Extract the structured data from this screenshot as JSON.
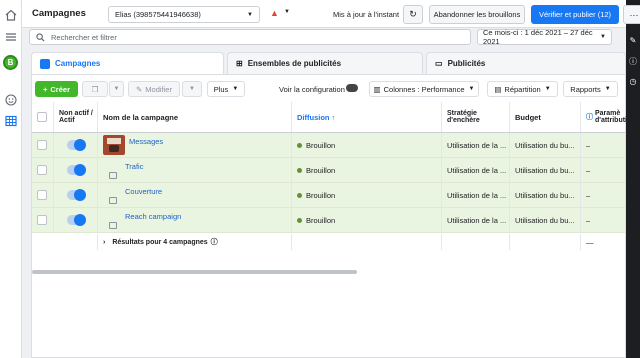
{
  "header": {
    "title": "Campagnes",
    "account": "Elias (398575441946638)",
    "status": "Mis à jour à l'instant",
    "discard_label": "Abandonner les brouillons",
    "publish_label": "Vérifier et publier (12)",
    "more_label": "···"
  },
  "rail": {
    "avatar_letter": "B"
  },
  "search": {
    "placeholder": "Rechercher et filtrer",
    "date_range": "Ce mois-ci : 1 déc 2021 – 27 déc 2021"
  },
  "tabs": [
    {
      "label": "Campagnes"
    },
    {
      "label": "Ensembles de publicités"
    },
    {
      "label": "Publicités"
    }
  ],
  "toolbar": {
    "create_label": "Créer",
    "edit_label": "Modifier",
    "more_label": "Plus",
    "view_config_label": "Voir la configuration",
    "columns_label": "Colonnes : Performance",
    "breakdown_label": "Répartition",
    "reports_label": "Rapports"
  },
  "table": {
    "headers": {
      "active": "Non actif / Actif",
      "name": "Nom de la campagne",
      "delivery": "Diffusion",
      "bid": "Stratégie d'enchère",
      "budget": "Budget",
      "attribution": "Paramè d'attributio"
    },
    "rows": [
      {
        "name": "Messages",
        "delivery": "Brouillon",
        "bid": "Utilisation de la ...",
        "budget": "Utilisation du bu...",
        "attribution": "–"
      },
      {
        "name": "Trafic",
        "delivery": "Brouillon",
        "bid": "Utilisation de la ...",
        "budget": "Utilisation du bu...",
        "attribution": "–"
      },
      {
        "name": "Couverture",
        "delivery": "Brouillon",
        "bid": "Utilisation de la ...",
        "budget": "Utilisation du bu...",
        "attribution": "–"
      },
      {
        "name": "Reach campaign",
        "delivery": "Brouillon",
        "bid": "Utilisation de la ...",
        "budget": "Utilisation du bu...",
        "attribution": "–"
      }
    ],
    "results_label": "Résultats pour 4 campagnes",
    "results_attribution": "—"
  },
  "colors": {
    "accent": "#1877f2",
    "create": "#42b72a",
    "row_bg": "#eaf5e1"
  }
}
